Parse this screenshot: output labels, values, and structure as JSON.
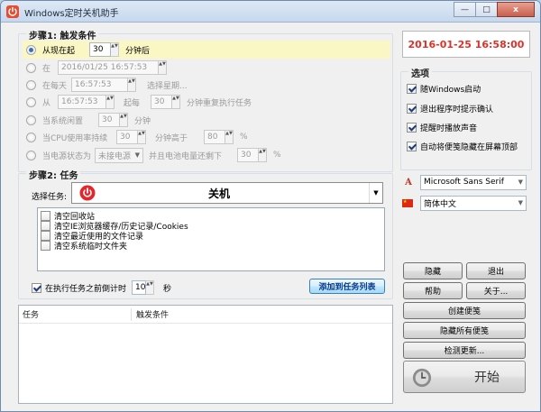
{
  "window": {
    "title": "Windows定时关机助手",
    "caption": {
      "minimize": "—",
      "maximize": "□",
      "close": "x"
    }
  },
  "step1": {
    "title": "步骤1: 触发条件",
    "options": [
      {
        "label": "从现在起",
        "value": "30",
        "suffix": "分钟后",
        "checked": true
      },
      {
        "label": "在",
        "value": "2016/01/25  16:57:53"
      },
      {
        "label": "在每天",
        "value": "16:57:53",
        "extra": "选择星期..."
      },
      {
        "label": "从",
        "value": "16:57:53",
        "mid": "起每",
        "value2": "30",
        "suffix": "分钟重复执行任务"
      },
      {
        "label": "当系统闲置",
        "value": "30",
        "suffix": "分钟"
      },
      {
        "label": "当CPU使用率持续",
        "value": "30",
        "mid": "分钟高于",
        "value2": "80",
        "suffix": "%"
      },
      {
        "label": "当电源状态为",
        "select": "未接电源",
        "mid": "并且电池电量还剩下",
        "value2": "30",
        "suffix": "%"
      }
    ]
  },
  "datetime": "2016-01-25 16:58:00",
  "options_panel": {
    "title": "选项",
    "items": [
      {
        "label": "随Windows启动",
        "checked": true
      },
      {
        "label": "退出程序时提示确认",
        "checked": true
      },
      {
        "label": "提醒时播放声音",
        "checked": true
      },
      {
        "label": "自动将便笺隐藏在屏幕顶部",
        "checked": true
      }
    ]
  },
  "font_select": "Microsoft Sans Serif",
  "lang_select": "简体中文",
  "step2": {
    "title": "步骤2: 任务",
    "select_label": "选择任务:",
    "task": "关机",
    "sub_items": [
      {
        "label": "清空回收站"
      },
      {
        "label": "清空IE浏览器缓存/历史记录/Cookies"
      },
      {
        "label": "清空最近使用的文件记录"
      },
      {
        "label": "清空系统临时文件夹"
      }
    ]
  },
  "countdown": {
    "label": "在执行任务之前倒计时",
    "value": "10",
    "unit": "秒",
    "checked": true
  },
  "add_button": "添加到任务列表",
  "task_list": {
    "col1": "任务",
    "col2": "触发条件"
  },
  "buttons": {
    "hide": "隐藏",
    "exit": "退出",
    "help": "帮助",
    "about": "关于...",
    "create_note": "创建便笺",
    "hide_notes": "隐藏所有便笺",
    "check_update": "检测更新...",
    "start": "开始"
  }
}
